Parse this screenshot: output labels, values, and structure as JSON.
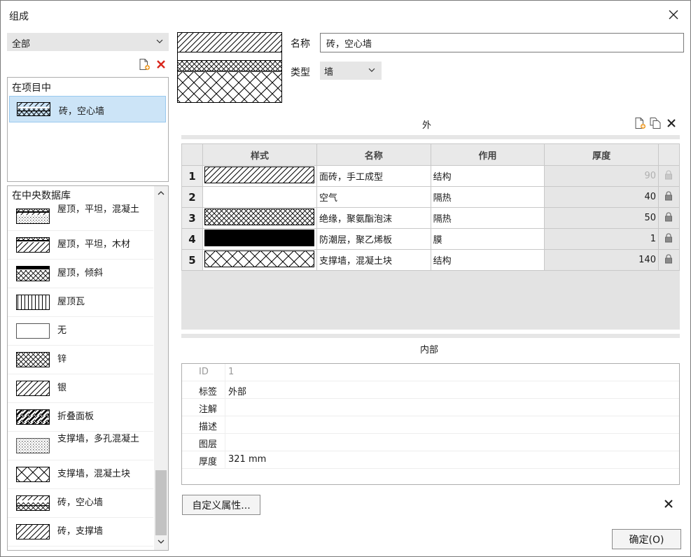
{
  "window": {
    "title": "组成"
  },
  "filter": {
    "selected": "全部"
  },
  "project_list": {
    "header": "在项目中",
    "items": [
      {
        "label": "砖，空心墙",
        "pattern": "brick-hollow"
      }
    ]
  },
  "library": {
    "header": "在中央数据库",
    "items": [
      {
        "label": "屋顶，平坦，混凝土",
        "pattern": "roof-flat-concrete"
      },
      {
        "label": "屋顶，平坦，木材",
        "pattern": "roof-flat-wood"
      },
      {
        "label": "屋顶，倾斜",
        "pattern": "roof-sloped"
      },
      {
        "label": "屋顶瓦",
        "pattern": "vertical-lines"
      },
      {
        "label": "无",
        "pattern": "none"
      },
      {
        "label": "锌",
        "pattern": "crosshatch"
      },
      {
        "label": "银",
        "pattern": "diagonal"
      },
      {
        "label": "折叠面板",
        "pattern": "diagonal-bold"
      },
      {
        "label": "支撑墙，多孔混凝土",
        "pattern": "dotted-grid"
      },
      {
        "label": "支撑墙，混凝土块",
        "pattern": "crosshatch-large"
      },
      {
        "label": "砖，空心墙",
        "pattern": "brick-hollow"
      },
      {
        "label": "砖，支撑墙",
        "pattern": "diagonal"
      }
    ]
  },
  "detail": {
    "name_label": "名称",
    "name_value": "砖，空心墙",
    "type_label": "类型",
    "type_value": "墙"
  },
  "outer_section": {
    "title": "外"
  },
  "layers": {
    "headers": [
      "样式",
      "名称",
      "作用",
      "厚度"
    ],
    "rows": [
      {
        "num": "1",
        "pattern": "diagonal",
        "name": "面砖，手工成型",
        "role": "结构",
        "thickness": "90",
        "locked_dim": true
      },
      {
        "num": "2",
        "pattern": "none",
        "name": "空气",
        "role": "隔热",
        "thickness": "40",
        "locked_dim": false
      },
      {
        "num": "3",
        "pattern": "crosshatch",
        "name": "绝缘，聚氨酯泡沫",
        "role": "隔热",
        "thickness": "50",
        "locked_dim": false
      },
      {
        "num": "4",
        "pattern": "solid",
        "name": "防潮层，聚乙烯板",
        "role": "膜",
        "thickness": "1",
        "locked_dim": false
      },
      {
        "num": "5",
        "pattern": "crosshatch-large",
        "name": "支撑墙，混凝土块",
        "role": "结构",
        "thickness": "140",
        "locked_dim": false
      }
    ]
  },
  "inner_section": {
    "title": "内部"
  },
  "properties": [
    {
      "key": "ID",
      "value": "1",
      "dim": true
    },
    {
      "key": "标签",
      "value": "外部",
      "dim": false
    },
    {
      "key": "注解",
      "value": "",
      "dim": false
    },
    {
      "key": "描述",
      "value": "",
      "dim": false
    },
    {
      "key": "图层",
      "value": "",
      "dim": false
    },
    {
      "key": "厚度",
      "value": "321 mm",
      "dim": false
    }
  ],
  "buttons": {
    "custom_props": "自定义属性...",
    "ok": "确定(O)"
  },
  "colors": {
    "selection": "#cce4f7",
    "delete_red": "#d9261c",
    "add_orange": "#f0a030"
  }
}
